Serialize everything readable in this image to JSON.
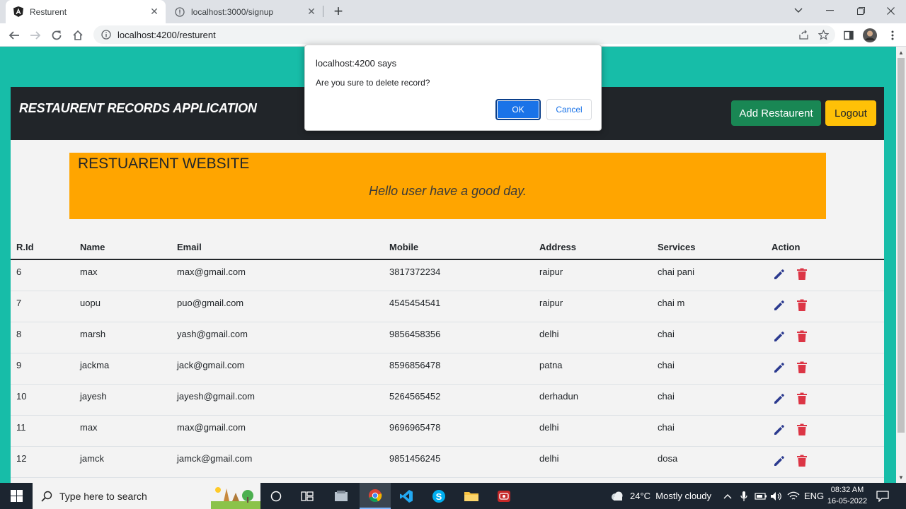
{
  "browser": {
    "tabs": [
      {
        "title": "Resturent",
        "active": true
      },
      {
        "title": "localhost:3000/signup",
        "active": false
      }
    ],
    "url": "localhost:4200/resturent"
  },
  "app": {
    "brand": "RESTAURENT RECORDS APPLICATION",
    "add_button": "Add Restaurent",
    "logout_button": "Logout",
    "jumbotron": {
      "title": "RESTUARENT WEBSITE",
      "subtitle": "Hello user have a good day."
    },
    "table": {
      "headers": [
        "R.Id",
        "Name",
        "Email",
        "Mobile",
        "Address",
        "Services",
        "Action"
      ],
      "rows": [
        {
          "id": "6",
          "name": "max",
          "email": "max@gmail.com",
          "mobile": "3817372234",
          "address": "raipur",
          "services": "chai pani"
        },
        {
          "id": "7",
          "name": "uopu",
          "email": "puo@gmail.com",
          "mobile": "4545454541",
          "address": "raipur",
          "services": "chai m"
        },
        {
          "id": "8",
          "name": "marsh",
          "email": "yash@gmail.com",
          "mobile": "9856458356",
          "address": "delhi",
          "services": "chai"
        },
        {
          "id": "9",
          "name": "jackma",
          "email": "jack@gmail.com",
          "mobile": "8596856478",
          "address": "patna",
          "services": "chai"
        },
        {
          "id": "10",
          "name": "jayesh",
          "email": "jayesh@gmail.com",
          "mobile": "5264565452",
          "address": "derhadun",
          "services": "chai"
        },
        {
          "id": "11",
          "name": "max",
          "email": "max@gmail.com",
          "mobile": "9696965478",
          "address": "delhi",
          "services": "chai"
        },
        {
          "id": "12",
          "name": "jamck",
          "email": "jamck@gmail.com",
          "mobile": "9851456245",
          "address": "delhi",
          "services": "dosa"
        }
      ]
    }
  },
  "dialog": {
    "title": "localhost:4200 says",
    "message": "Are you sure to delete record?",
    "ok": "OK",
    "cancel": "Cancel"
  },
  "taskbar": {
    "search_placeholder": "Type here to search",
    "weather": "24°C  Mostly cloudy",
    "language": "ENG",
    "time": "08:32 AM",
    "date": "16-05-2022"
  },
  "colors": {
    "page_bg": "#17bda8",
    "navbar": "#212529",
    "add_button": "#198754",
    "logout_button": "#ffc107",
    "jumbotron": "#ffa500",
    "edit_icon": "#2b3a8f",
    "delete_icon": "#dc3545"
  }
}
